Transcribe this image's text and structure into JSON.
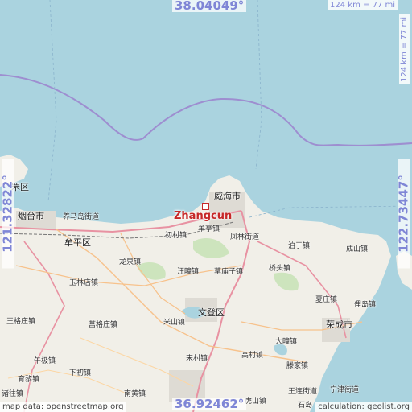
{
  "map": {
    "marker": {
      "label": "Zhangcun"
    },
    "coordinates": {
      "top_lat": "38.04049°",
      "bottom_lat": "36.92462°",
      "left_lon": "121.32822°",
      "right_lon": "122.73447°"
    },
    "scale": {
      "horizontal": "124 km = 77 mi",
      "vertical": "124 km = 77 mi"
    },
    "attribution": {
      "source": "map data: openstreetmap.org",
      "calculation": "calculation: geolist.org"
    },
    "places": [
      {
        "name": "罘区",
        "kind": "city"
      },
      {
        "name": "烟台市",
        "kind": "city"
      },
      {
        "name": "养马岛街道",
        "kind": "town"
      },
      {
        "name": "牟平区",
        "kind": "city"
      },
      {
        "name": "威海市",
        "kind": "city"
      },
      {
        "name": "羊亭镇",
        "kind": "town"
      },
      {
        "name": "初村镇",
        "kind": "town"
      },
      {
        "name": "凤林街道",
        "kind": "town"
      },
      {
        "name": "泊于镇",
        "kind": "town"
      },
      {
        "name": "成山镇",
        "kind": "town"
      },
      {
        "name": "龙泉镇",
        "kind": "town"
      },
      {
        "name": "汪疃镇",
        "kind": "town"
      },
      {
        "name": "草庙子镇",
        "kind": "town"
      },
      {
        "name": "桥头镇",
        "kind": "town"
      },
      {
        "name": "玉林店镇",
        "kind": "town"
      },
      {
        "name": "文登区",
        "kind": "city"
      },
      {
        "name": "夏庄镇",
        "kind": "town"
      },
      {
        "name": "俚岛镇",
        "kind": "town"
      },
      {
        "name": "王格庄镇",
        "kind": "town"
      },
      {
        "name": "莒格庄镇",
        "kind": "town"
      },
      {
        "name": "米山镇",
        "kind": "town"
      },
      {
        "name": "荣成市",
        "kind": "city"
      },
      {
        "name": "大疃镇",
        "kind": "town"
      },
      {
        "name": "午极镇",
        "kind": "town"
      },
      {
        "name": "高村镇",
        "kind": "town"
      },
      {
        "name": "宋村镇",
        "kind": "town"
      },
      {
        "name": "滕家镇",
        "kind": "town"
      },
      {
        "name": "育黎镇",
        "kind": "town"
      },
      {
        "name": "下初镇",
        "kind": "town"
      },
      {
        "name": "诸往镇",
        "kind": "town"
      },
      {
        "name": "南黄镇",
        "kind": "town"
      },
      {
        "name": "虎山镇",
        "kind": "town"
      },
      {
        "name": "王连街道",
        "kind": "town"
      },
      {
        "name": "宁津街道",
        "kind": "town"
      },
      {
        "name": "石岛",
        "kind": "town"
      }
    ]
  }
}
